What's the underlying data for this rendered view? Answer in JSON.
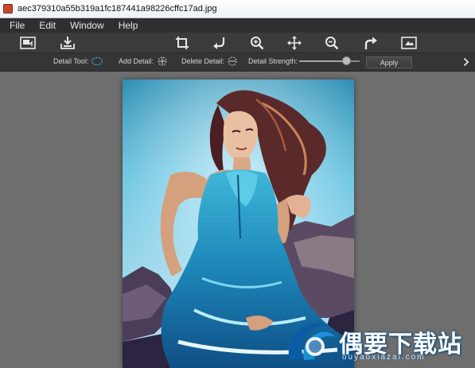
{
  "window": {
    "title": "aec379310a55b319a1fc187441a98226cffc17ad.jpg"
  },
  "menu": [
    "File",
    "Edit",
    "Window",
    "Help"
  ],
  "toolbar": {
    "icons": [
      "open-image-icon",
      "save-download-icon",
      "crop-icon",
      "rotate-left-icon",
      "zoom-in-icon",
      "move-icon",
      "zoom-out-icon",
      "redo-icon",
      "fit-image-icon"
    ]
  },
  "options": {
    "detail_tool": "Detail Tool:",
    "add_detail": "Add Detail:",
    "delete_detail": "Delete Detail:",
    "detail_strength": "Detail Strength:",
    "strength_value": 0.78,
    "apply": "Apply"
  },
  "watermark": {
    "text": "偶要下载站",
    "sub": "ouyaoxiazai.com"
  },
  "colors": {
    "menubar": "#2f2f2f",
    "toolbar": "#3b3b3b",
    "canvas": "#6e6e6e",
    "accent": "#4ab0e0"
  }
}
